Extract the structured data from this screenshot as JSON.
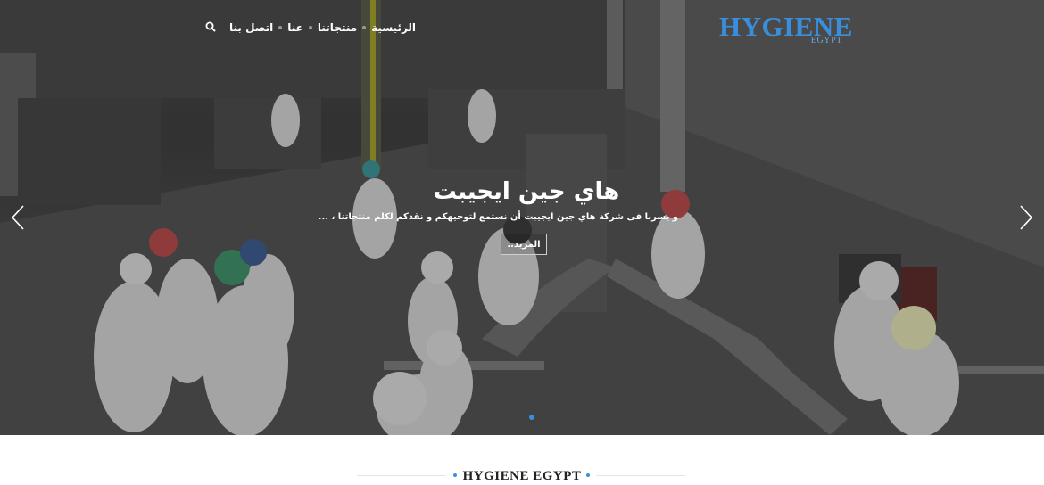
{
  "brand": {
    "logo_main": "HYGIENE",
    "logo_sub": "EGYPT",
    "accent_color": "#3a8fdc"
  },
  "nav": {
    "items": [
      {
        "label": "الرئيسية"
      },
      {
        "label": "منتجاتنا"
      },
      {
        "label": "عنا"
      },
      {
        "label": "اتصل بنا"
      }
    ],
    "search_icon": "search-icon"
  },
  "hero": {
    "title": "هاي جين ايجيبت",
    "subtitle": "و يسرنا فى شركة هاي جين ايجيبت أن نستمع لتوجيهكم و نقدكم لكلم منتجاتنا ، ...",
    "more_button": "المزيد..",
    "prev_icon": "chevron-left-icon",
    "next_icon": "chevron-right-icon",
    "image": "factory-workers-production-line"
  },
  "section": {
    "heading": "HYGIENE EGYPT"
  }
}
